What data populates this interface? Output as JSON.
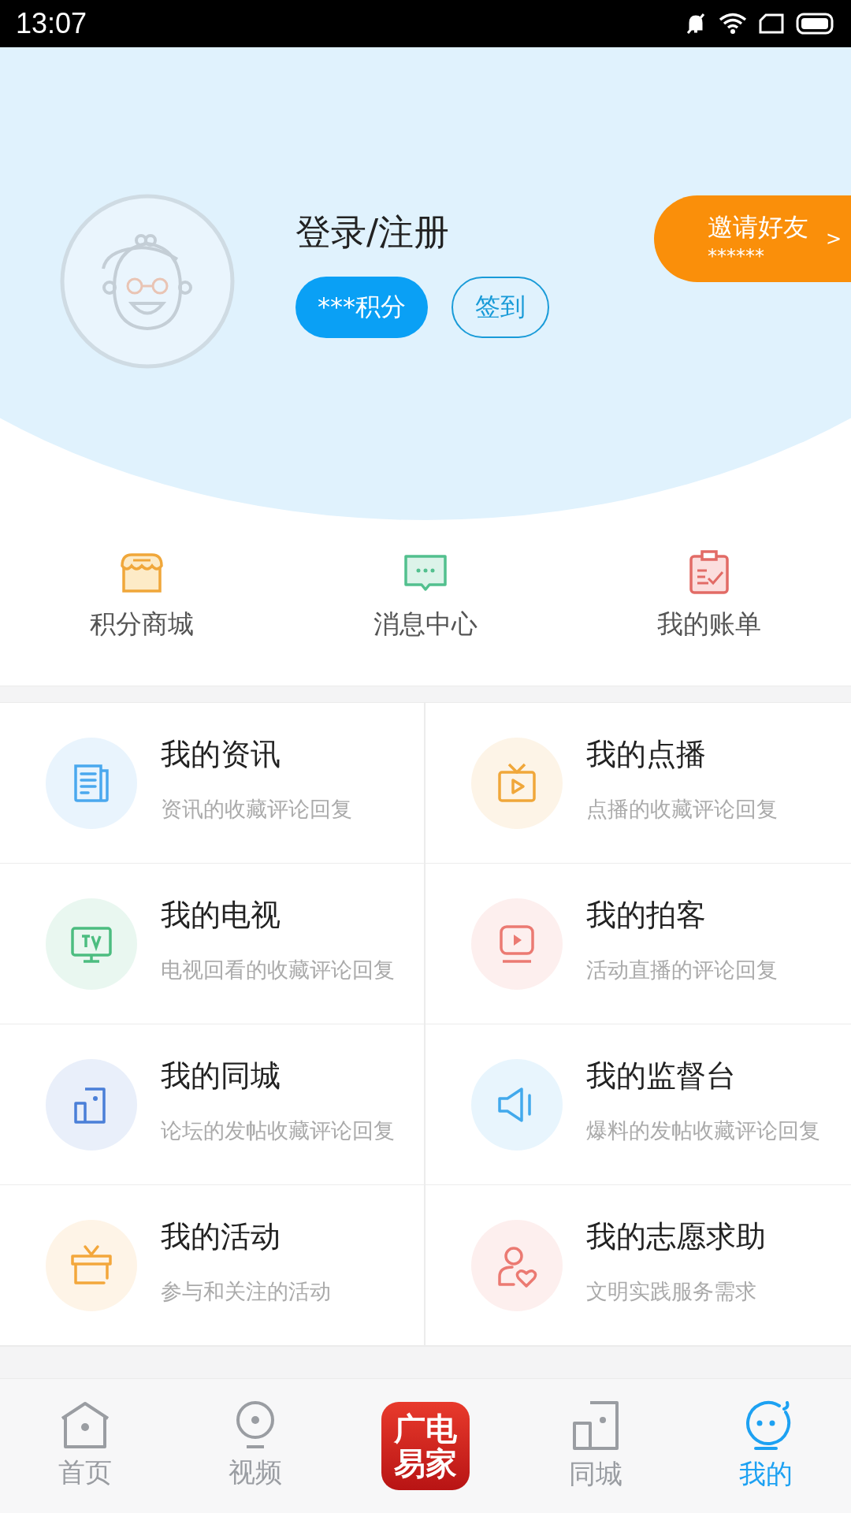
{
  "status_bar": {
    "time": "13:07"
  },
  "profile": {
    "title": "登录/注册",
    "points_button": "***积分",
    "checkin_button": "签到",
    "invite": {
      "title": "邀请好友",
      "subtitle": "******",
      "arrow": ">"
    }
  },
  "shortcuts": [
    {
      "kind": "shop",
      "label": "积分商城"
    },
    {
      "kind": "message",
      "label": "消息中心"
    },
    {
      "kind": "bill",
      "label": "我的账单"
    }
  ],
  "menu": [
    {
      "kind": "news",
      "title": "我的资讯",
      "subtitle": "资讯的收藏评论回复",
      "color": "#4aa8ee"
    },
    {
      "kind": "vod",
      "title": "我的点播",
      "subtitle": "点播的收藏评论回复",
      "color": "#f0a73a"
    },
    {
      "kind": "tv",
      "title": "我的电视",
      "subtitle": "电视回看的收藏评论回复",
      "color": "#4cbd80"
    },
    {
      "kind": "clip",
      "title": "我的拍客",
      "subtitle": "活动直播的评论回复",
      "color": "#eb7a72"
    },
    {
      "kind": "city",
      "title": "我的同城",
      "subtitle": "论坛的发帖收藏评论回复",
      "color": "#4a7fd8"
    },
    {
      "kind": "speaker",
      "title": "我的监督台",
      "subtitle": "爆料的发帖收藏评论回复",
      "color": "#42a9ec"
    },
    {
      "kind": "gift",
      "title": "我的活动",
      "subtitle": "参与和关注的活动",
      "color": "#f3a73c"
    },
    {
      "kind": "volunteer",
      "title": "我的志愿求助",
      "subtitle": "文明实践服务需求",
      "color": "#eb7a72"
    }
  ],
  "tabs": [
    {
      "kind": "home",
      "label": "首页",
      "selected": false
    },
    {
      "kind": "video",
      "label": "视频",
      "selected": false
    },
    {
      "kind": "logo",
      "lines": [
        "广电",
        "易家"
      ],
      "selected": false
    },
    {
      "kind": "city",
      "label": "同城",
      "selected": false
    },
    {
      "kind": "me",
      "label": "我的",
      "selected": true
    }
  ]
}
